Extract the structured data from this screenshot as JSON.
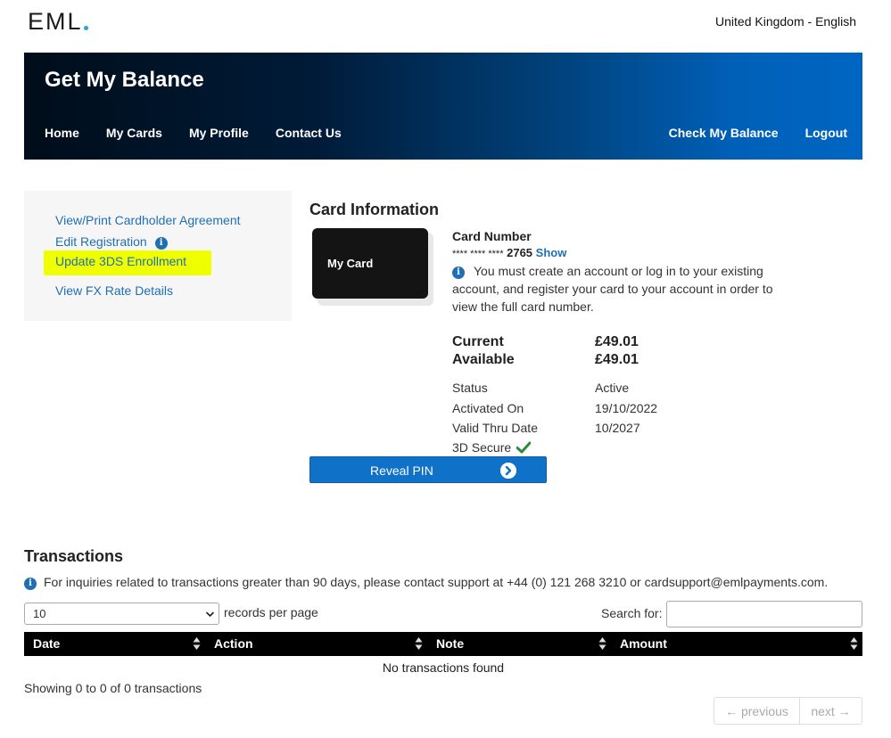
{
  "header": {
    "logo_text": "EML",
    "locale": "United Kingdom - English"
  },
  "banner": {
    "title": "Get My Balance",
    "nav_left": [
      "Home",
      "My Cards",
      "My Profile",
      "Contact Us"
    ],
    "nav_right": [
      "Check My Balance",
      "Logout"
    ]
  },
  "sidebar": {
    "links": [
      "View/Print Cardholder Agreement",
      "Edit Registration",
      "Update 3DS Enrollment",
      "View FX Rate Details"
    ],
    "highlight_color": "#f0ff00"
  },
  "card": {
    "section_title": "Card Information",
    "card_image_label": "My Card",
    "number_label": "Card Number",
    "masked": "**** **** ****",
    "last4": "2765",
    "show_label": "Show",
    "note": "You must create an account or log in to your existing account, and register your card to your account in order to view the full card number.",
    "balances": [
      {
        "label": "Current",
        "value": "£49.01"
      },
      {
        "label": "Available",
        "value": "£49.01"
      }
    ],
    "details": [
      {
        "key": "Status",
        "value": "Active"
      },
      {
        "key": "Activated On",
        "value": "19/10/2022"
      },
      {
        "key": "Valid Thru Date",
        "value": "10/2027"
      },
      {
        "key": "3D Secure",
        "value": ""
      }
    ],
    "secure_icon": "check-icon",
    "secure_color": "#2e8b3a",
    "reveal_label": "Reveal PIN"
  },
  "transactions": {
    "title": "Transactions",
    "note": "For inquiries related to transactions greater than 90 days, please contact support at +44 (0) 121 268 3210 or cardsupport@emlpayments.com.",
    "page_length": "10",
    "records_label": "records per page",
    "search_label": "Search for:",
    "search_value": "",
    "columns": [
      "Date",
      "Action",
      "Note",
      "Amount"
    ],
    "empty_text": "No transactions found",
    "info_text": "Showing 0 to 0 of 0 transactions",
    "prev_label": "← previous",
    "next_label": "next →"
  },
  "colors": {
    "accent": "#0f72c8",
    "link": "#1f6fb5"
  }
}
